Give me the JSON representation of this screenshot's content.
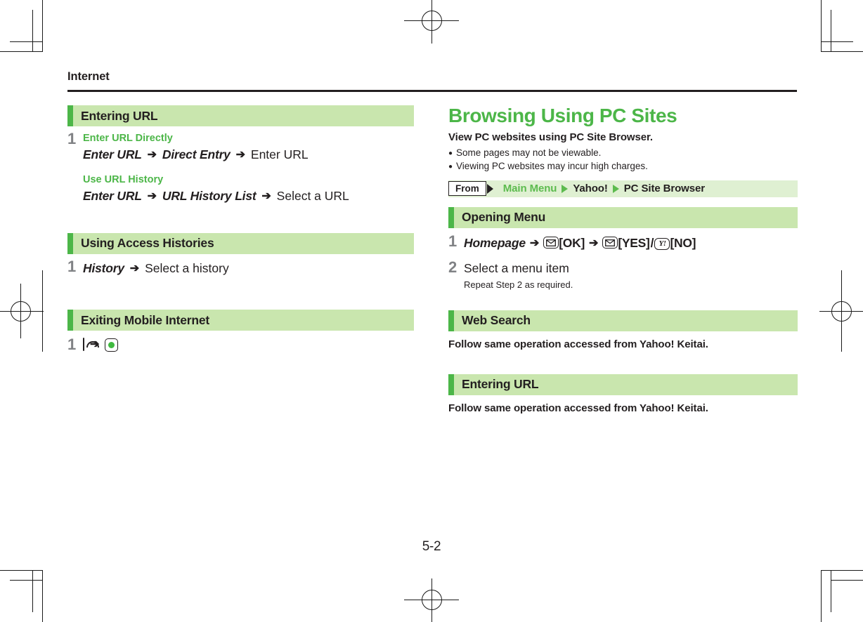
{
  "page": {
    "running_head": "Internet",
    "page_number": "5-2"
  },
  "left_column": {
    "sections": [
      {
        "title": "Entering URL",
        "steps": [
          {
            "number": "1",
            "groups": [
              {
                "label": "Enter URL Directly",
                "menu_items": [
                  "Enter URL",
                  "Direct Entry"
                ],
                "final": "Enter URL"
              },
              {
                "label": "Use URL History",
                "menu_items": [
                  "Enter URL",
                  "URL History List"
                ],
                "final": "Select a URL"
              }
            ]
          }
        ]
      },
      {
        "title": "Using Access Histories",
        "steps": [
          {
            "number": "1",
            "menu_items": [
              "History"
            ],
            "final": "Select a history"
          }
        ]
      },
      {
        "title": "Exiting Mobile Internet",
        "steps": [
          {
            "number": "1",
            "keys": [
              "end-call-key",
              "center-key"
            ]
          }
        ]
      }
    ]
  },
  "right_column": {
    "chapter_title": "Browsing Using PC Sites",
    "lead": "View PC websites using PC Site Browser.",
    "bullets": [
      "Some pages may not be viewable.",
      "Viewing PC websites may incur high charges."
    ],
    "from_strip": {
      "chip_label": "From",
      "path": [
        {
          "text": "Main Menu",
          "style": "green"
        },
        {
          "text": "Yahoo!",
          "style": "dark"
        },
        {
          "text": "PC Site Browser",
          "style": "dark"
        }
      ]
    },
    "sections": [
      {
        "title": "Opening Menu",
        "steps": [
          {
            "number": "1",
            "menu_item": "Homepage",
            "key_ok_label": "[OK]",
            "key_yes_label": "[YES]",
            "key_no_label": "[NO]",
            "separator": "/"
          },
          {
            "number": "2",
            "text": "Select a menu item",
            "note": "Repeat Step 2 as required."
          }
        ]
      },
      {
        "title": "Web Search",
        "body": "Follow same operation accessed from Yahoo! Keitai."
      },
      {
        "title": "Entering URL",
        "body": "Follow same operation accessed from Yahoo! Keitai."
      }
    ]
  },
  "symbols": {
    "arrow": "➔",
    "bullet_dot": "●"
  },
  "colors": {
    "accent_green": "#4cb648",
    "section_bg": "#c9e6ae",
    "from_strip_bg": "#dff0d2",
    "text": "#231f20",
    "step_number": "#808285"
  }
}
